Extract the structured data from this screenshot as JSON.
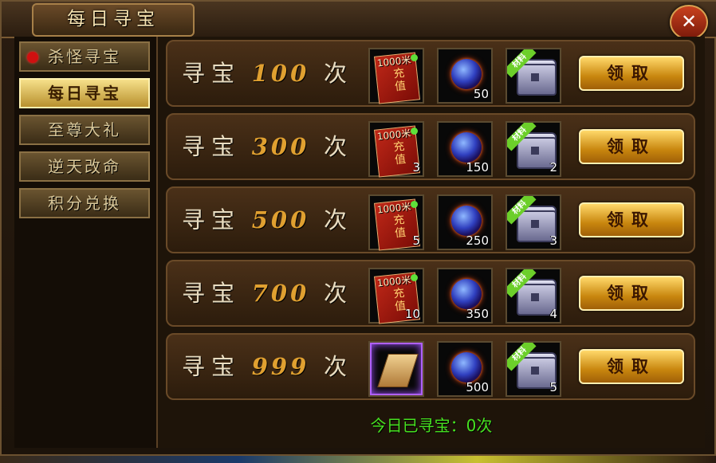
{
  "window": {
    "title": "每日寻宝",
    "close_label": "✕"
  },
  "sidebar": {
    "items": [
      {
        "label": "杀怪寻宝",
        "dot": true
      },
      {
        "label": "每日寻宝",
        "active": true
      },
      {
        "label": "至尊大礼"
      },
      {
        "label": "逆天改命"
      },
      {
        "label": "积分兑换"
      }
    ]
  },
  "rows": [
    {
      "prefix": "寻宝",
      "count": "100",
      "suffix": "次",
      "rewards": [
        {
          "icon": "recharge-card",
          "amount": "1000米",
          "text": "充值",
          "qty": ""
        },
        {
          "icon": "fire-orb",
          "qty": "50"
        },
        {
          "icon": "material-chest",
          "tag": "材料",
          "qty": ""
        }
      ],
      "button": "领取"
    },
    {
      "prefix": "寻宝",
      "count": "300",
      "suffix": "次",
      "rewards": [
        {
          "icon": "recharge-card",
          "amount": "1000米",
          "text": "充值",
          "qty": "3"
        },
        {
          "icon": "fire-orb",
          "qty": "150"
        },
        {
          "icon": "material-chest",
          "tag": "材料",
          "qty": "2"
        }
      ],
      "button": "领取"
    },
    {
      "prefix": "寻宝",
      "count": "500",
      "suffix": "次",
      "rewards": [
        {
          "icon": "recharge-card",
          "amount": "1000米",
          "text": "充值",
          "qty": "5"
        },
        {
          "icon": "fire-orb",
          "qty": "250"
        },
        {
          "icon": "material-chest",
          "tag": "材料",
          "qty": "3"
        }
      ],
      "button": "领取"
    },
    {
      "prefix": "寻宝",
      "count": "700",
      "suffix": "次",
      "rewards": [
        {
          "icon": "recharge-card",
          "amount": "1000米",
          "text": "充值",
          "qty": "10"
        },
        {
          "icon": "fire-orb",
          "qty": "350"
        },
        {
          "icon": "material-chest",
          "tag": "材料",
          "qty": "4"
        }
      ],
      "button": "领取"
    },
    {
      "prefix": "寻宝",
      "count": "999",
      "suffix": "次",
      "rewards": [
        {
          "icon": "magic-scroll",
          "qty": ""
        },
        {
          "icon": "fire-orb",
          "qty": "500"
        },
        {
          "icon": "material-chest",
          "tag": "材料",
          "qty": "5"
        }
      ],
      "button": "领取"
    }
  ],
  "footer": {
    "today_text": "今日已寻宝：0次"
  },
  "colors": {
    "accent_gold": "#e0a030",
    "status_green": "#46e020",
    "alert_red": "#d01010"
  }
}
